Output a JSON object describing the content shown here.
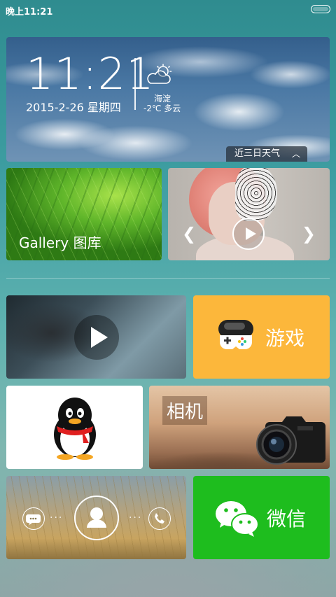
{
  "status_bar": {
    "time": "晚上11:21"
  },
  "weather_widget": {
    "time": "11:21",
    "date": "2015-2-26 星期四",
    "location": "海淀",
    "condition": "-2℃ 多云",
    "forecast_button": "近三日天气",
    "weather_icon": "partly-cloudy-icon"
  },
  "gallery": {
    "label": "Gallery 图库"
  },
  "music": {
    "prev_icon": "chevron-left-icon",
    "next_icon": "chevron-right-icon",
    "play_icon": "play-icon"
  },
  "video": {
    "play_icon": "play-icon"
  },
  "games": {
    "label": "游戏",
    "icon": "gamepad-icon",
    "color": "#FCB73B"
  },
  "qq": {
    "icon": "qq-penguin-icon"
  },
  "camera": {
    "label": "相机",
    "icon": "camera-icon"
  },
  "dialer": {
    "message_icon": "message-icon",
    "contact_icon": "contact-icon",
    "call_icon": "phone-icon"
  },
  "wechat": {
    "label": "微信",
    "icon": "wechat-icon",
    "color": "#1EBD1E"
  }
}
